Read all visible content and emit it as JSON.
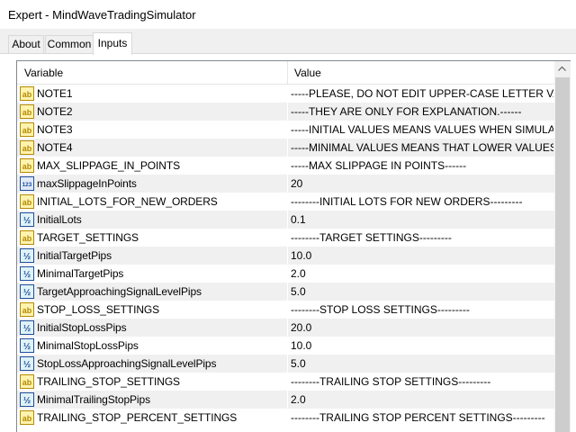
{
  "window": {
    "title": "Expert - MindWaveTradingSimulator"
  },
  "tabs": [
    {
      "label": "About",
      "active": false
    },
    {
      "label": "Common",
      "active": false
    },
    {
      "label": "Inputs",
      "active": true
    }
  ],
  "table": {
    "columns": {
      "variable": "Variable",
      "value": "Value"
    },
    "rows": [
      {
        "icon": "ab",
        "name": "NOTE1",
        "value": "-----PLEASE, DO NOT EDIT UPPER-CASE LETTER VARI..."
      },
      {
        "icon": "ab",
        "name": "NOTE2",
        "value": "-----THEY ARE ONLY FOR EXPLANATION.------"
      },
      {
        "icon": "ab",
        "name": "NOTE3",
        "value": "-----INITIAL VALUES MEANS VALUES WHEN SIMULATO..."
      },
      {
        "icon": "ab",
        "name": "NOTE4",
        "value": "-----MINIMAL VALUES MEANS THAT LOWER VALUES C..."
      },
      {
        "icon": "ab",
        "name": "MAX_SLIPPAGE_IN_POINTS",
        "value": "-----MAX SLIPPAGE IN POINTS------"
      },
      {
        "icon": "123",
        "name": "maxSlippageInPoints",
        "value": "20"
      },
      {
        "icon": "ab",
        "name": "INITIAL_LOTS_FOR_NEW_ORDERS",
        "value": "--------INITIAL LOTS FOR NEW ORDERS---------"
      },
      {
        "icon": "frac",
        "name": "InitialLots",
        "value": "0.1"
      },
      {
        "icon": "ab",
        "name": "TARGET_SETTINGS",
        "value": "--------TARGET SETTINGS---------"
      },
      {
        "icon": "frac",
        "name": "InitialTargetPips",
        "value": "10.0"
      },
      {
        "icon": "frac",
        "name": "MinimalTargetPips",
        "value": "2.0"
      },
      {
        "icon": "frac",
        "name": "TargetApproachingSignalLevelPips",
        "value": "5.0"
      },
      {
        "icon": "ab",
        "name": "STOP_LOSS_SETTINGS",
        "value": "--------STOP LOSS SETTINGS---------"
      },
      {
        "icon": "frac",
        "name": "InitialStopLossPips",
        "value": "20.0"
      },
      {
        "icon": "frac",
        "name": "MinimalStopLossPips",
        "value": "10.0"
      },
      {
        "icon": "frac",
        "name": "StopLossApproachingSignalLevelPips",
        "value": "5.0"
      },
      {
        "icon": "ab",
        "name": "TRAILING_STOP_SETTINGS",
        "value": "--------TRAILING STOP SETTINGS---------"
      },
      {
        "icon": "frac",
        "name": "MinimalTrailingStopPips",
        "value": "2.0"
      },
      {
        "icon": "ab",
        "name": "TRAILING_STOP_PERCENT_SETTINGS",
        "value": "--------TRAILING STOP PERCENT SETTINGS---------"
      }
    ]
  },
  "icons": {
    "ab": {
      "name": "string-type-icon",
      "text": "ab",
      "color": "#b58a00",
      "bg": "#fff3b0"
    },
    "123": {
      "name": "integer-type-icon",
      "text": "123",
      "color": "#1f4e9c",
      "bg": "#dfe9f7"
    },
    "frac": {
      "name": "double-type-icon",
      "text": "½",
      "color": "#1f4e9c",
      "bg": "#dff3f7"
    }
  }
}
